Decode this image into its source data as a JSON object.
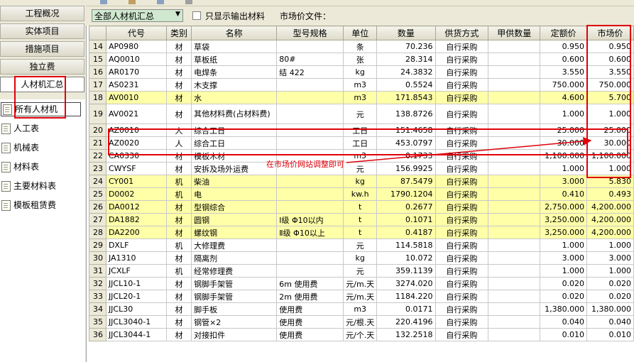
{
  "nav": {
    "buttons": [
      "工程概况",
      "实体项目",
      "措施项目",
      "独立费",
      "人材机汇总"
    ],
    "tree": [
      "所有人材机",
      "人工表",
      "机械表",
      "材料表",
      "主要材料表",
      "模板租赁费"
    ]
  },
  "toolbar": {
    "filter_value": "全部人材机汇总",
    "checkbox_label": "只显示输出材料",
    "price_file_label": "市场价文件："
  },
  "table": {
    "columns": [
      "",
      "代号",
      "类别",
      "名称",
      "型号规格",
      "单位",
      "数量",
      "供货方式",
      "甲供数量",
      "定额价",
      "市场价"
    ],
    "rows": [
      {
        "n": "14",
        "code": "AP0980",
        "cat": "材",
        "name": "草袋",
        "spec": "",
        "unit": "条",
        "qty": "70.236",
        "supply": "自行采购",
        "jia": "",
        "quota": "0.950",
        "market": "0.950",
        "hl": false
      },
      {
        "n": "15",
        "code": "AQ0010",
        "cat": "材",
        "name": "草板纸",
        "spec": "80#",
        "unit": "张",
        "qty": "28.314",
        "supply": "自行采购",
        "jia": "",
        "quota": "0.600",
        "market": "0.600",
        "hl": false
      },
      {
        "n": "16",
        "code": "AR0170",
        "cat": "材",
        "name": "电焊条",
        "spec": "结 422",
        "unit": "kg",
        "qty": "24.3832",
        "supply": "自行采购",
        "jia": "",
        "quota": "3.550",
        "market": "3.550",
        "hl": false
      },
      {
        "n": "17",
        "code": "AS0231",
        "cat": "材",
        "name": "木支撑",
        "spec": "",
        "unit": "m3",
        "qty": "0.5524",
        "supply": "自行采购",
        "jia": "",
        "quota": "750.000",
        "market": "750.000",
        "hl": false
      },
      {
        "n": "18",
        "code": "AV0010",
        "cat": "材",
        "name": "水",
        "spec": "",
        "unit": "m3",
        "qty": "171.8543",
        "supply": "自行采购",
        "jia": "",
        "quota": "4.600",
        "market": "5.700",
        "hl": true
      },
      {
        "n": "19",
        "code": "AV0021",
        "cat": "材",
        "name": "其他材料费(占材料费)",
        "spec": "",
        "unit": "元",
        "qty": "138.8726",
        "supply": "自行采购",
        "jia": "",
        "quota": "1.000",
        "market": "1.000",
        "hl": false,
        "tall": true
      },
      {
        "n": "20",
        "code": "AZ0010",
        "cat": "人",
        "name": "综合工日",
        "spec": "",
        "unit": "工日",
        "qty": "151.4658",
        "supply": "自行采购",
        "jia": "",
        "quota": "25.000",
        "market": "25.000",
        "hl": false
      },
      {
        "n": "21",
        "code": "AZ0020",
        "cat": "人",
        "name": "综合工日",
        "spec": "",
        "unit": "工日",
        "qty": "453.0797",
        "supply": "自行采购",
        "jia": "",
        "quota": "30.000",
        "market": "30.000",
        "hl": false
      },
      {
        "n": "22",
        "code": "CA0330",
        "cat": "材",
        "name": "模板木材",
        "spec": "",
        "unit": "m3",
        "qty": "0.1733",
        "supply": "自行采购",
        "jia": "",
        "quota": "1,100.000",
        "market": "1,100.000",
        "hl": false
      },
      {
        "n": "23",
        "code": "CWYSF",
        "cat": "材",
        "name": "安拆及场外运费",
        "spec": "",
        "unit": "元",
        "qty": "156.9925",
        "supply": "自行采购",
        "jia": "",
        "quota": "1.000",
        "market": "1.000",
        "hl": false
      },
      {
        "n": "24",
        "code": "CY001",
        "cat": "机",
        "name": "柴油",
        "spec": "",
        "unit": "kg",
        "qty": "87.5479",
        "supply": "自行采购",
        "jia": "",
        "quota": "3.000",
        "market": "5.830",
        "hl": true
      },
      {
        "n": "25",
        "code": "D0002",
        "cat": "机",
        "name": "电",
        "spec": "",
        "unit": "kw.h",
        "qty": "1790.1204",
        "supply": "自行采购",
        "jia": "",
        "quota": "0.410",
        "market": "0.493",
        "hl": true
      },
      {
        "n": "26",
        "code": "DA0012",
        "cat": "材",
        "name": "型钢综合",
        "spec": "",
        "unit": "t",
        "qty": "0.2677",
        "supply": "自行采购",
        "jia": "",
        "quota": "2,750.000",
        "market": "4,200.000",
        "hl": true
      },
      {
        "n": "27",
        "code": "DA1882",
        "cat": "材",
        "name": "圆钢",
        "spec": "Ⅰ级 Φ10以内",
        "unit": "t",
        "qty": "0.1071",
        "supply": "自行采购",
        "jia": "",
        "quota": "3,250.000",
        "market": "4,200.000",
        "hl": true
      },
      {
        "n": "28",
        "code": "DA2200",
        "cat": "材",
        "name": "螺纹钢",
        "spec": "Ⅱ级 Φ10以上",
        "unit": "t",
        "qty": "0.4187",
        "supply": "自行采购",
        "jia": "",
        "quota": "3,250.000",
        "market": "4,200.000",
        "hl": true
      },
      {
        "n": "29",
        "code": "DXLF",
        "cat": "机",
        "name": "大修理费",
        "spec": "",
        "unit": "元",
        "qty": "114.5818",
        "supply": "自行采购",
        "jia": "",
        "quota": "1.000",
        "market": "1.000",
        "hl": false
      },
      {
        "n": "30",
        "code": "JA1310",
        "cat": "材",
        "name": "隔离剂",
        "spec": "",
        "unit": "kg",
        "qty": "10.072",
        "supply": "自行采购",
        "jia": "",
        "quota": "3.000",
        "market": "3.000",
        "hl": false
      },
      {
        "n": "31",
        "code": "JCXLF",
        "cat": "机",
        "name": "经常修理费",
        "spec": "",
        "unit": "元",
        "qty": "359.1139",
        "supply": "自行采购",
        "jia": "",
        "quota": "1.000",
        "market": "1.000",
        "hl": false
      },
      {
        "n": "32",
        "code": "JJCL10-1",
        "cat": "材",
        "name": "钢脚手架管",
        "spec": "6m 使用费",
        "unit": "元/m.天",
        "qty": "3274.020",
        "supply": "自行采购",
        "jia": "",
        "quota": "0.020",
        "market": "0.020",
        "hl": false
      },
      {
        "n": "33",
        "code": "JJCL20-1",
        "cat": "材",
        "name": "钢脚手架管",
        "spec": "2m 使用费",
        "unit": "元/m.天",
        "qty": "1184.220",
        "supply": "自行采购",
        "jia": "",
        "quota": "0.020",
        "market": "0.020",
        "hl": false
      },
      {
        "n": "34",
        "code": "JJCL30",
        "cat": "材",
        "name": "脚手板",
        "spec": "使用费",
        "unit": "m3",
        "qty": "0.0171",
        "supply": "自行采购",
        "jia": "",
        "quota": "1,380.000",
        "market": "1,380.000",
        "hl": false
      },
      {
        "n": "35",
        "code": "JJCL3040-1",
        "cat": "材",
        "name": "钢管×2",
        "spec": "使用费",
        "unit": "元/根.天",
        "qty": "220.4196",
        "supply": "自行采购",
        "jia": "",
        "quota": "0.040",
        "market": "0.040",
        "hl": false
      },
      {
        "n": "36",
        "code": "JJCL3044-1",
        "cat": "材",
        "name": "对接扣件",
        "spec": "使用费",
        "unit": "元/个.天",
        "qty": "132.2518",
        "supply": "自行采购",
        "jia": "",
        "quota": "0.010",
        "market": "0.010",
        "hl": false
      }
    ]
  },
  "annotation": {
    "text": "在市场价网站调整即可",
    "color": "#e0000a"
  },
  "colors": {
    "highlight_row": "#ffffa8",
    "filter_bg": "#cfe8cf",
    "panel_bg": "#ece9d8"
  }
}
